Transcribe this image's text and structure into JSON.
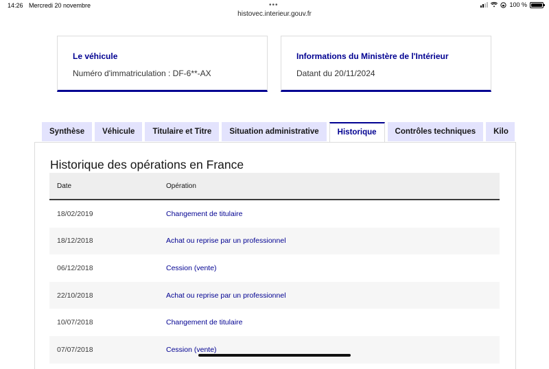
{
  "status_bar": {
    "time": "14:26",
    "date": "Mercredi 20 novembre",
    "battery": "100 %"
  },
  "url": "histovec.interieur.gouv.fr",
  "cards": {
    "vehicle": {
      "title": "Le véhicule",
      "text": "Numéro d'immatriculation : DF-6**-AX"
    },
    "ministry": {
      "title": "Informations du Ministère de l'Intérieur",
      "text": "Datant du 20/11/2024"
    }
  },
  "tabs": [
    {
      "label": "Synthèse",
      "active": false
    },
    {
      "label": "Véhicule",
      "active": false
    },
    {
      "label": "Titulaire et Titre",
      "active": false
    },
    {
      "label": "Situation administrative",
      "active": false
    },
    {
      "label": "Historique",
      "active": true
    },
    {
      "label": "Contrôles techniques",
      "active": false
    },
    {
      "label": "Kilo",
      "active": false
    }
  ],
  "history": {
    "title": "Historique des opérations en France",
    "columns": [
      "Date",
      "Opération"
    ],
    "rows": [
      {
        "date": "18/02/2019",
        "operation": "Changement de titulaire"
      },
      {
        "date": "18/12/2018",
        "operation": "Achat ou reprise par un professionnel"
      },
      {
        "date": "06/12/2018",
        "operation": "Cession (vente)"
      },
      {
        "date": "22/10/2018",
        "operation": "Achat ou reprise par un professionnel"
      },
      {
        "date": "10/07/2018",
        "operation": "Changement de titulaire"
      },
      {
        "date": "07/07/2018",
        "operation": "Cession (vente)"
      }
    ]
  },
  "colors": {
    "accent": "#000091",
    "tab_bg": "#e3e3fd"
  }
}
